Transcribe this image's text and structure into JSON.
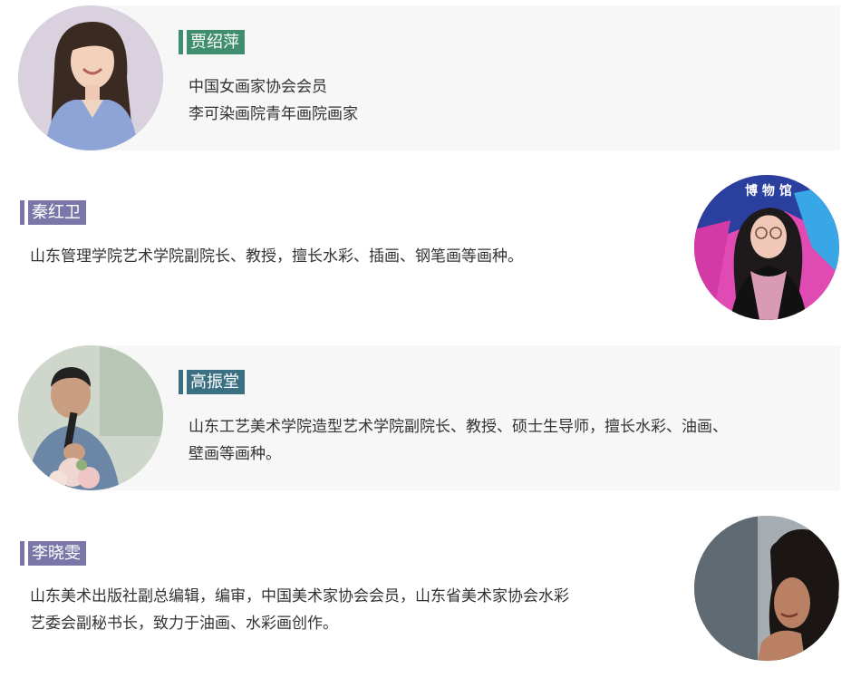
{
  "colors": {
    "panel_bg": "#f7f7f7",
    "green_tag": "#3e8e6f",
    "purple_tag": "#7b76a8",
    "teal_tag": "#3b6f82",
    "text": "#333333"
  },
  "profiles": [
    {
      "name": "贾绍萍",
      "lines": [
        "中国女画家协会会员",
        "李可染画院青年画院画家"
      ],
      "tag_color": "green",
      "photo_icon": "woman-portrait-photo"
    },
    {
      "name": "秦红卫",
      "lines": [
        "山东管理学院艺术学院副院长、教授，擅长水彩、插画、钢笔画等画种。"
      ],
      "tag_color": "purple",
      "photo_icon": "woman-museum-portrait-photo",
      "photo_sign": "博 物 馆"
    },
    {
      "name": "高振堂",
      "lines": [
        "山东工艺美术学院造型艺术学院副院长、教授、硕士生导师，擅长水彩、油画、",
        "壁画等画种。"
      ],
      "tag_color": "teal",
      "photo_icon": "man-speaking-microphone-photo"
    },
    {
      "name": "李晓雯",
      "lines": [
        "山东美术出版社副总编辑，编审，中国美术家协会会员，山东省美术家协会水彩",
        "艺委会副秘书长，致力于油画、水彩画创作。"
      ],
      "tag_color": "purple",
      "photo_icon": "woman-curly-hair-photo"
    }
  ]
}
